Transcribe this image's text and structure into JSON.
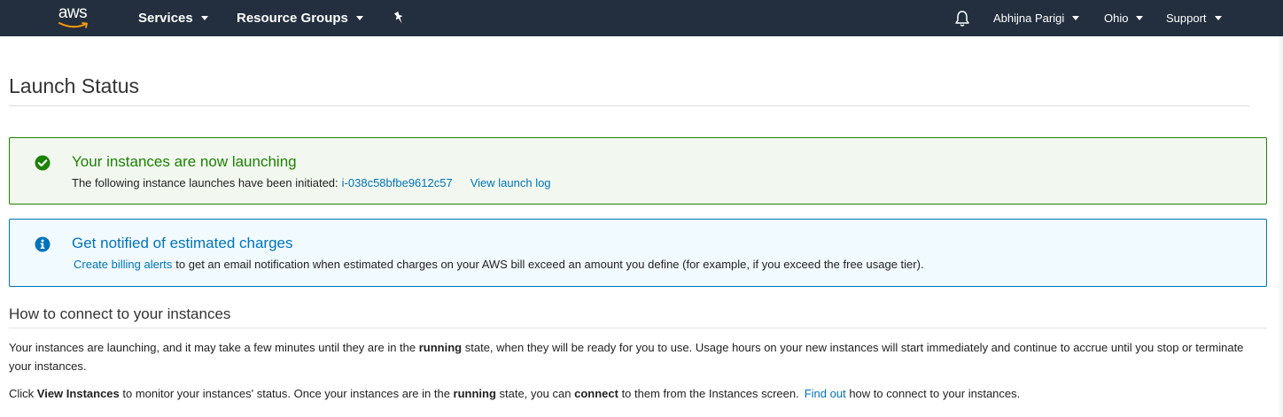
{
  "header": {
    "logo_text": "aws",
    "services_label": "Services",
    "resource_groups_label": "Resource Groups",
    "pin_icon": "pin-icon",
    "bell_icon": "bell-icon",
    "user_label": "Abhijna Parigi",
    "region_label": "Ohio",
    "support_label": "Support"
  },
  "page": {
    "title": "Launch Status"
  },
  "success_alert": {
    "icon": "check-circle-icon",
    "heading": "Your instances are now launching",
    "body_text": "The following instance launches have been initiated:",
    "instance_id": "i-038c58bfbe9612c57",
    "view_log_label": "View launch log"
  },
  "info_alert": {
    "icon": "info-circle-icon",
    "heading": "Get notified of estimated charges",
    "link_label": "Create billing alerts",
    "body_text": "to get an email notification when estimated charges on your AWS bill exceed an amount you define (for example, if you exceed the free usage tier)."
  },
  "connect_section": {
    "title": "How to connect to your instances",
    "p1_a": "Your instances are launching, and it may take a few minutes until they are in the ",
    "p1_bold": "running",
    "p1_b": " state, when they will be ready for you to use. Usage hours on your new instances will start immediately and continue to accrue until you stop or terminate your instances.",
    "p2_a": "Click ",
    "p2_bold1": "View Instances",
    "p2_b": " to monitor your instances' status. Once your instances are in the ",
    "p2_bold2": "running",
    "p2_c": " state, you can ",
    "p2_bold3": "connect",
    "p2_d": " to them from the Instances screen.",
    "p2_link": "Find out",
    "p2_e": " how to connect to your instances."
  },
  "colors": {
    "nav_bg": "#232f3e",
    "success": "#1d8102",
    "info": "#0073bb",
    "link": "#0073bb",
    "smile": "#ff9900"
  }
}
